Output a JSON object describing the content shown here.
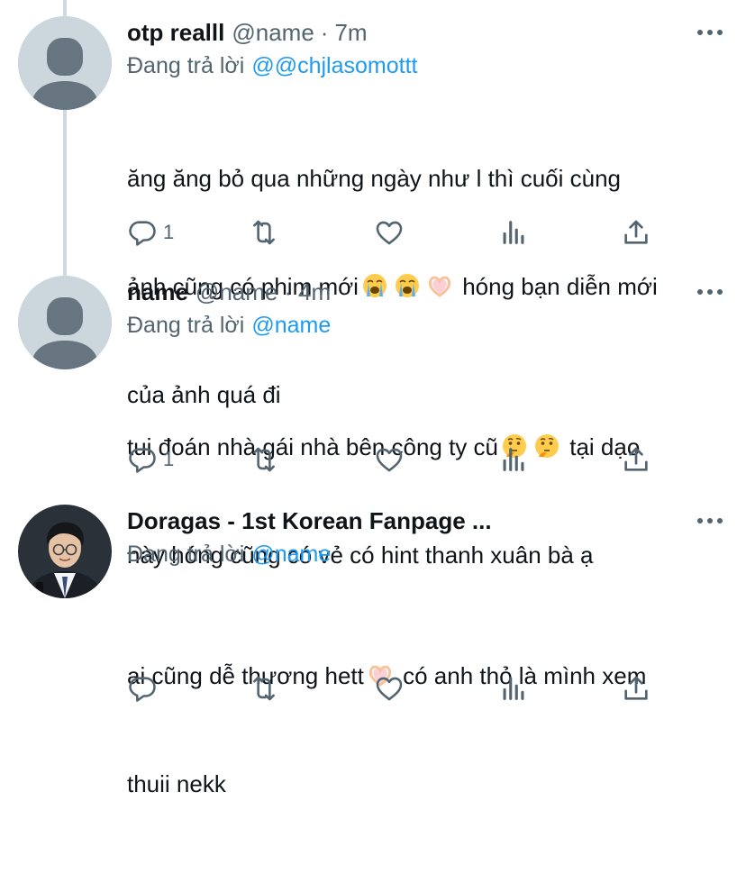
{
  "tweets": [
    {
      "display_name": "otp realll",
      "handle": "@name",
      "separator": "·",
      "time": "7m",
      "reply_prefix": "Đang trả lời",
      "reply_target": "@@chjlasomottt",
      "text_line1": "ăng ăng bỏ qua những ngày như l thì cuối cùng",
      "text_line2a": "ảnh cũng có phim mới",
      "text_line2b": "hóng bạn diễn mới",
      "text_line3": "của ảnh quá đi",
      "reply_count": "1",
      "emojis": [
        "loudly-crying-face",
        "loudly-crying-face",
        "heart-hands"
      ]
    },
    {
      "display_name": "name",
      "handle": "@name",
      "separator": "·",
      "time": "4m",
      "reply_prefix": "Đang trả lời",
      "reply_target": "@name",
      "text_line1a": "tui đoán nhà gái nhà bên công ty cũ",
      "text_line1b": "tại dạo",
      "text_line2": "này hóng cũng có vẻ có hint thanh xuân bà ạ",
      "reply_count": "1",
      "emojis": [
        "thinking-face",
        "thinking-face"
      ]
    },
    {
      "display_name": "Doragas - 1st Korean Fanpage ...",
      "reply_prefix": "Đang trả lời",
      "reply_target": "@name",
      "text_line1a": "ai cũng dễ thương hett",
      "text_line1b": "có anh thỏ là mình xem",
      "text_line2": "thuii nekk",
      "emojis": [
        "heart-hands"
      ]
    }
  ],
  "icons": [
    "reply-icon",
    "retweet-icon",
    "like-icon",
    "analytics-icon",
    "share-icon",
    "more-icon"
  ],
  "colors": {
    "link": "#1d9bf0",
    "secondary_text": "#536471",
    "thread_line": "#cfd9de",
    "default_avatar": "#ccd6dd"
  }
}
